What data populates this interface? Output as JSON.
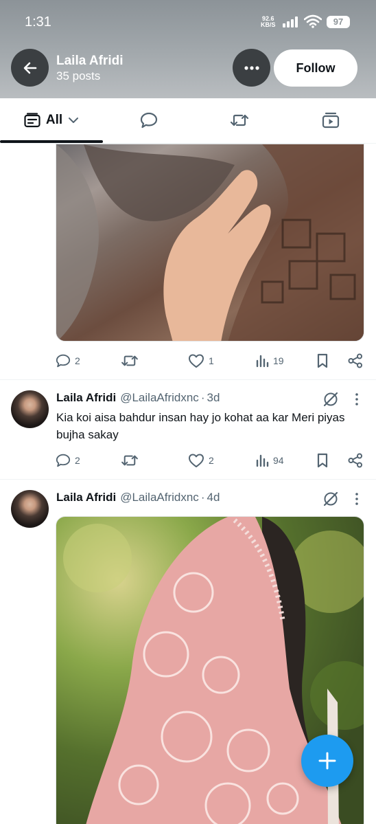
{
  "status_bar": {
    "time": "1:31",
    "net_speed_value": "92.6",
    "net_speed_unit": "KB/S",
    "battery": "97"
  },
  "header": {
    "name": "Laila Afridi",
    "post_count": "35 posts",
    "follow_label": "Follow"
  },
  "tabs": {
    "all_label": "All"
  },
  "posts": [
    {
      "stats": {
        "replies": "2",
        "reposts": "",
        "likes": "1",
        "views": "19"
      }
    },
    {
      "name": "Laila Afridi",
      "handle": "@LailaAfridxnc",
      "separator": "·",
      "age": "3d",
      "text": "Kia koi aisa bahdur insan hay jo kohat aa kar Meri piyas bujha sakay",
      "stats": {
        "replies": "2",
        "reposts": "",
        "likes": "2",
        "views": "94"
      }
    },
    {
      "name": "Laila Afridi",
      "handle": "@LailaAfridxnc",
      "separator": "·",
      "age": "4d"
    }
  ],
  "colors": {
    "accent": "#1d9bf0",
    "text_primary": "#0f1419",
    "text_secondary": "#536471",
    "header_bg": "#a3a9ad"
  },
  "icons": [
    "back-arrow-icon",
    "more-horizontal-icon",
    "filter-all-icon",
    "chevron-down-icon",
    "reply-bubble-icon",
    "repost-icon",
    "media-play-icon",
    "like-heart-icon",
    "views-bar-icon",
    "bookmark-icon",
    "share-icon",
    "grok-icon",
    "vertical-dots-icon",
    "plus-icon"
  ]
}
